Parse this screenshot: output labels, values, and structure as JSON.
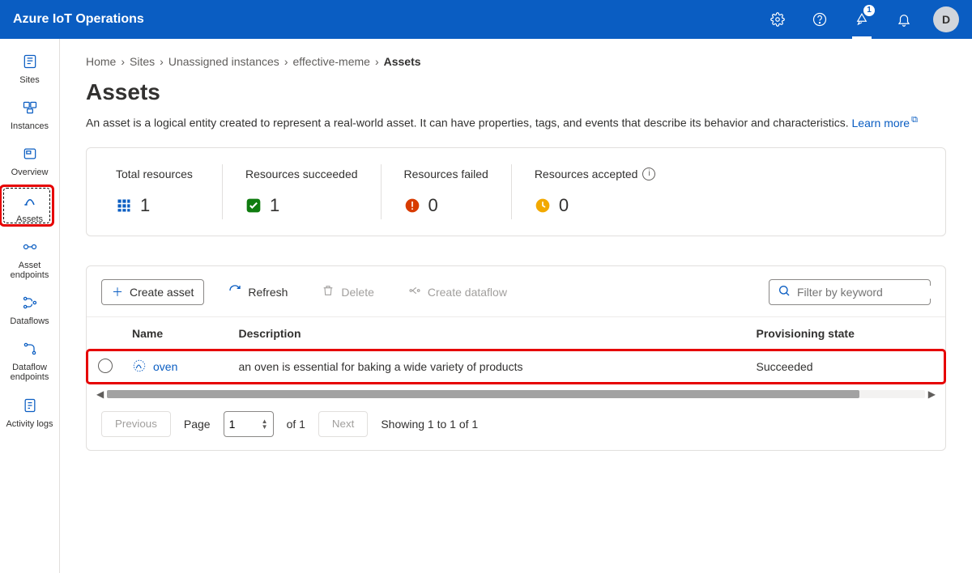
{
  "header": {
    "brand": "Azure IoT Operations",
    "feedback_badge": "1",
    "avatar_initial": "D"
  },
  "sidebar": {
    "items": [
      {
        "label": "Sites"
      },
      {
        "label": "Instances"
      },
      {
        "label": "Overview"
      },
      {
        "label": "Assets"
      },
      {
        "label": "Asset endpoints"
      },
      {
        "label": "Dataflows"
      },
      {
        "label": "Dataflow endpoints"
      },
      {
        "label": "Activity logs"
      }
    ]
  },
  "breadcrumb": {
    "items": [
      "Home",
      "Sites",
      "Unassigned instances",
      "effective-meme"
    ],
    "current": "Assets"
  },
  "page": {
    "title": "Assets",
    "description": "An asset is a logical entity created to represent a real-world asset. It can have properties, tags, and events that describe its behavior and characteristics.",
    "learn_more": "Learn more"
  },
  "stats": [
    {
      "label": "Total resources",
      "value": "1",
      "icon": "grid",
      "icon_color": "#0a5dc2"
    },
    {
      "label": "Resources succeeded",
      "value": "1",
      "icon": "check",
      "icon_color": "#107c10"
    },
    {
      "label": "Resources failed",
      "value": "0",
      "icon": "error",
      "icon_color": "#d83b01"
    },
    {
      "label": "Resources accepted",
      "value": "0",
      "icon": "clock",
      "icon_color": "#f2a900",
      "info": true
    }
  ],
  "toolbar": {
    "create_label": "Create asset",
    "refresh_label": "Refresh",
    "delete_label": "Delete",
    "dataflow_label": "Create dataflow",
    "filter_placeholder": "Filter by keyword"
  },
  "table": {
    "columns": {
      "name": "Name",
      "description": "Description",
      "state": "Provisioning state"
    },
    "rows": [
      {
        "name": "oven",
        "description": "an oven is essential for baking a wide variety of products",
        "state": "Succeeded"
      }
    ]
  },
  "pager": {
    "prev": "Previous",
    "next": "Next",
    "page_label": "Page",
    "page_value": "1",
    "of_text": "of 1",
    "showing": "Showing 1 to 1 of 1"
  }
}
